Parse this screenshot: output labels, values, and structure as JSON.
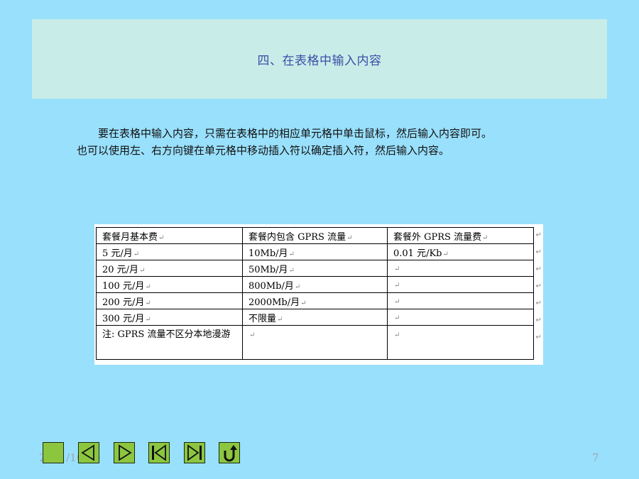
{
  "slide": {
    "title": "四、在表格中输入内容",
    "body_line1": "要在表格中输入内容，只需在表格中的相应单元格中单击鼠标，然后输入内容即可。",
    "body_line2": "也可以使用左、右方向键在单元格中移动插入符以确定插入符，然后输入内容。"
  },
  "table": {
    "headers": [
      "套餐月基本费",
      "套餐内包含 GPRS 流量",
      "套餐外 GPRS 流量费"
    ],
    "rows": [
      [
        "5 元/月",
        "10Mb/月",
        "0.01 元/Kb"
      ],
      [
        "20 元/月",
        "50Mb/月",
        ""
      ],
      [
        "100 元/月",
        "800Mb/月",
        ""
      ],
      [
        "200 元/月",
        "2000Mb/月",
        ""
      ],
      [
        "300 元/月",
        "不限量",
        ""
      ],
      [
        "注: GPRS 流量不区分本地漫游",
        "",
        ""
      ]
    ],
    "paragraph_mark": "↵"
  },
  "footer": {
    "date": "2021/10/10",
    "page": "7"
  },
  "nav": {
    "buttons": [
      "blank-icon",
      "prev-icon",
      "next-icon",
      "first-icon",
      "last-icon",
      "return-icon"
    ]
  }
}
